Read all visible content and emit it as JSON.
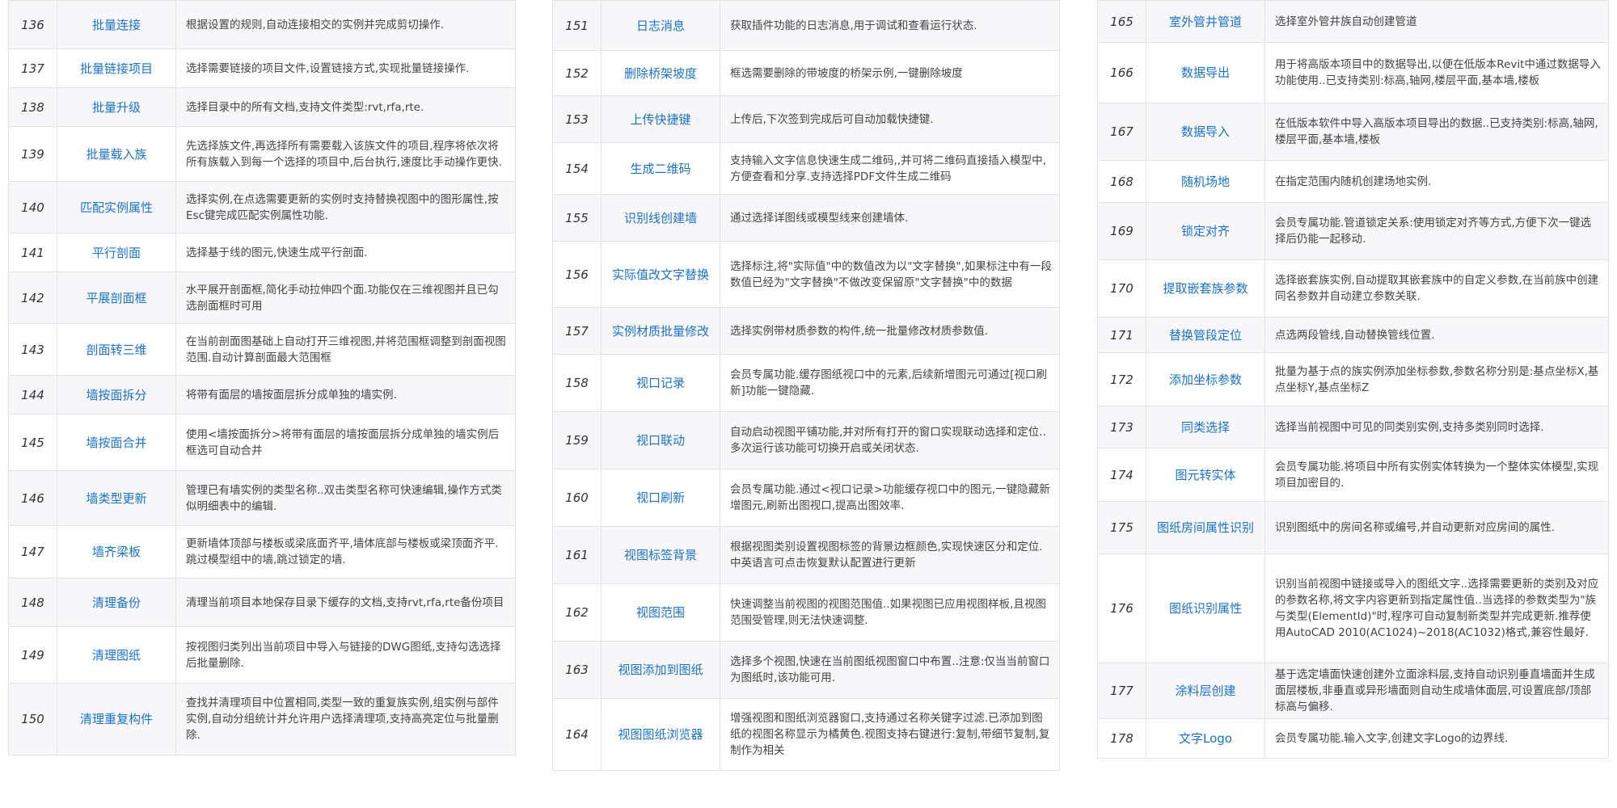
{
  "columns": [
    {
      "rows": [
        {
          "num": "136",
          "name": "批量连接",
          "desc": "根据设置的规则,自动连接相交的实例并完成剪切操作."
        },
        {
          "num": "137",
          "name": "批量链接项目",
          "desc": "选择需要链接的项目文件,设置链接方式,实现批量链接操作."
        },
        {
          "num": "138",
          "name": "批量升级",
          "desc": "选择目录中的所有文档,支持文件类型:rvt,rfa,rte."
        },
        {
          "num": "139",
          "name": "批量载入族",
          "desc": "先选择族文件,再选择所有需要载入该族文件的项目,程序将依次将所有族载入到每一个选择的项目中,后台执行,速度比手动操作更快."
        },
        {
          "num": "140",
          "name": "匹配实例属性",
          "desc": "选择实例,在点选需要更新的实例时支持替换视图中的图形属性,按Esc键完成匹配实例属性功能."
        },
        {
          "num": "141",
          "name": "平行剖面",
          "desc": "选择基于线的图元,快速生成平行剖面."
        },
        {
          "num": "142",
          "name": "平展剖面框",
          "desc": "水平展开剖面框,简化手动拉伸四个面.功能仅在三维视图并且已勾选剖面框时可用"
        },
        {
          "num": "143",
          "name": "剖面转三维",
          "desc": "在当前剖面图基础上自动打开三维视图,并将范围框调整到剖面视图范围.自动计算剖面最大范围框"
        },
        {
          "num": "144",
          "name": "墙按面拆分",
          "desc": "将带有面层的墙按面层拆分成单独的墙实例."
        },
        {
          "num": "145",
          "name": "墙按面合并",
          "desc": "使用<墙按面拆分>将带有面层的墙按面层拆分成单独的墙实例后框选可自动合并"
        },
        {
          "num": "146",
          "name": "墙类型更新",
          "desc": "管理已有墙实例的类型名称..双击类型名称可快速编辑,操作方式类似明细表中的编辑."
        },
        {
          "num": "147",
          "name": "墙齐梁板",
          "desc": "更新墙体顶部与楼板或梁底面齐平,墙体底部与楼板或梁顶面齐平.跳过模型组中的墙,跳过锁定的墙."
        },
        {
          "num": "148",
          "name": "清理备份",
          "desc": "清理当前项目本地保存目录下缓存的文档,支持rvt,rfa,rte备份项目"
        },
        {
          "num": "149",
          "name": "清理图纸",
          "desc": "按视图归类列出当前项目中导入与链接的DWG图纸,支持勾选选择后批量删除."
        },
        {
          "num": "150",
          "name": "清理重复构件",
          "desc": "查找并清理项目中位置相同,类型一致的重复族实例,组实例与部件实例,自动分组统计并允许用户选择清理项,支持高亮定位与批量删除."
        }
      ]
    },
    {
      "rows": [
        {
          "num": "151",
          "name": "日志消息",
          "desc": "获取插件功能的日志消息,用于调试和查看运行状态."
        },
        {
          "num": "152",
          "name": "删除桥架坡度",
          "desc": "框选需要删除的带坡度的桥架示例,一键删除坡度"
        },
        {
          "num": "153",
          "name": "上传快捷键",
          "desc": "上传后,下次签到完成后可自动加载快捷键."
        },
        {
          "num": "154",
          "name": "生成二维码",
          "desc": "支持输入文字信息快速生成二维码,,并可将二维码直接插入模型中,方便查看和分享.支持选择PDF文件生成二维码"
        },
        {
          "num": "155",
          "name": "识别线创建墙",
          "desc": "通过选择详图线或模型线来创建墙体."
        },
        {
          "num": "156",
          "name": "实际值改文字替换",
          "desc": "选择标注,将\"实际值\"中的数值改为以\"文字替换\",如果标注中有一段数值已经为\"文字替换\"不做改变保留原\"文字替换\"中的数据"
        },
        {
          "num": "157",
          "name": "实例材质批量修改",
          "desc": "选择实例带材质参数的构件,统一批量修改材质参数值."
        },
        {
          "num": "158",
          "name": "视口记录",
          "desc": "会员专属功能.缓存图纸视口中的元素,后续新增图元可通过[视口刷新]功能一键隐藏."
        },
        {
          "num": "159",
          "name": "视口联动",
          "desc": "自动启动视图平铺功能,并对所有打开的窗口实现联动选择和定位..多次运行该功能可切换开启或关闭状态."
        },
        {
          "num": "160",
          "name": "视口刷新",
          "desc": "会员专属功能.通过<视口记录>功能缓存视口中的图元,一键隐藏新增图元,刷新出图视口,提高出图效率."
        },
        {
          "num": "161",
          "name": "视图标签背景",
          "desc": "根据视图类别设置视图标签的背景边框颜色,实现快速区分和定位.中英语言可点击恢复默认配置进行更新"
        },
        {
          "num": "162",
          "name": "视图范围",
          "desc": "快速调整当前视图的视图范围值..如果视图已应用视图样板,且视图范围受管理,则无法快速调整."
        },
        {
          "num": "163",
          "name": "视图添加到图纸",
          "desc": "选择多个视图,快速在当前图纸视图窗口中布置..注意:仅当当前窗口为图纸时,该功能可用."
        },
        {
          "num": "164",
          "name": "视图图纸浏览器",
          "desc": "增强视图和图纸浏览器窗口,支持通过名称关键字过滤.已添加到图纸的视图名称显示为橘黄色.视图支持右键进行:复制,带细节复制,复制作为相关"
        }
      ]
    },
    {
      "rows": [
        {
          "num": "165",
          "name": "室外管井管道",
          "desc": "选择室外管井族自动创建管道"
        },
        {
          "num": "166",
          "name": "数据导出",
          "desc": "用于将高版本项目中的数据导出,以便在低版本Revit中通过数据导入功能使用..已支持类别:标高,轴网,楼层平面,基本墙,楼板"
        },
        {
          "num": "167",
          "name": "数据导入",
          "desc": "在低版本软件中导入高版本项目导出的数据..已支持类别:标高,轴网,楼层平面,基本墙,楼板"
        },
        {
          "num": "168",
          "name": "随机场地",
          "desc": "在指定范围内随机创建场地实例."
        },
        {
          "num": "169",
          "name": "锁定对齐",
          "desc": "会员专属功能.管道锁定关系:使用锁定对齐等方式,方便下次一键选择后仍能一起移动."
        },
        {
          "num": "170",
          "name": "提取嵌套族参数",
          "desc": "选择嵌套族实例,自动提取其嵌套族中的自定义参数,在当前族中创建同名参数并自动建立参数关联."
        },
        {
          "num": "171",
          "name": "替换管段定位",
          "desc": "点选两段管线,自动替换管线位置."
        },
        {
          "num": "172",
          "name": "添加坐标参数",
          "desc": "批量为基于点的族实例添加坐标参数,参数名称分别是:基点坐标X,基点坐标Y,基点坐标Z"
        },
        {
          "num": "173",
          "name": "同类选择",
          "desc": "选择当前视图中可见的同类别实例,支持多类别同时选择."
        },
        {
          "num": "174",
          "name": "图元转实体",
          "desc": "会员专属功能.将项目中所有实例实体转换为一个整体实体模型,实现项目加密目的."
        },
        {
          "num": "175",
          "name": "图纸房间属性识别",
          "desc": "识别图纸中的房间名称或编号,并自动更新对应房间的属性."
        },
        {
          "num": "176",
          "name": "图纸识别属性",
          "desc": "识别当前视图中链接或导入的图纸文字..选择需要更新的类别及对应的参数名称,将文字内容更新到指定属性值..当选择的参数类型为\"族与类型(ElementId)\"时,程序可自动复制新类型并完成更新.推荐使用AutoCAD 2010(AC1024)~2018(AC1032)格式,兼容性最好."
        },
        {
          "num": "177",
          "name": "涂料层创建",
          "desc": "基于选定墙面快速创建外立面涂料层,支持自动识别垂直墙面并生成面层楼板,非垂直或异形墙面则自动生成墙体面层,可设置底部/顶部标高与偏移."
        },
        {
          "num": "178",
          "name": "文字Logo",
          "desc": "会员专属功能.输入文字,创建文字Logo的边界线."
        }
      ]
    }
  ]
}
